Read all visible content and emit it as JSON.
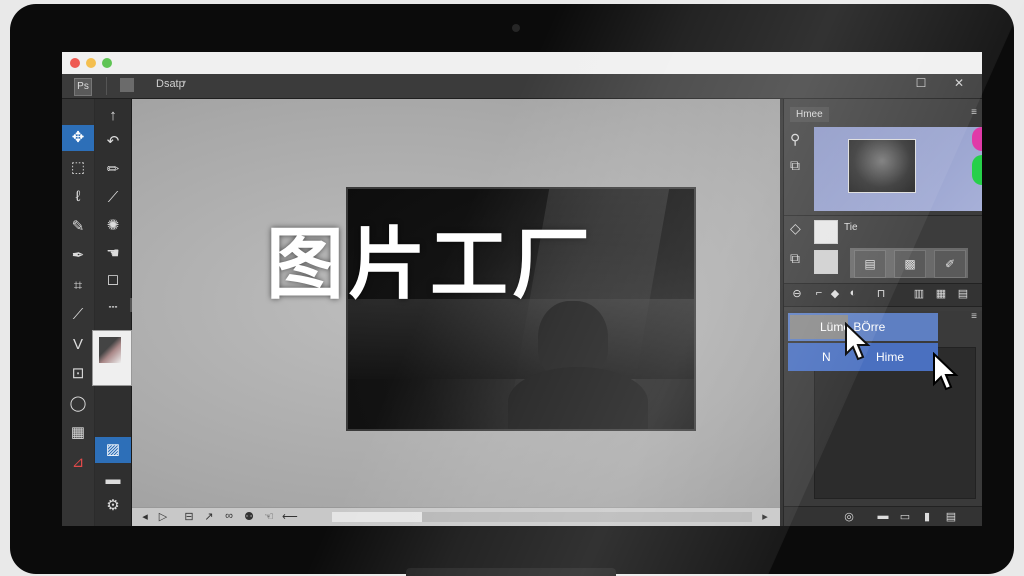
{
  "window": {
    "controls": [
      "close",
      "minimize",
      "maximize"
    ]
  },
  "menubar": {
    "logo_glyph": "Ps",
    "menu_label": "Dsatp",
    "dropdown_glyph": "▾",
    "restore_glyph": "☐",
    "close_glyph": "✕"
  },
  "tools_left": [
    {
      "name": "move-icon",
      "glyph": "✥",
      "active": true
    },
    {
      "name": "marquee-icon",
      "glyph": "⬚"
    },
    {
      "name": "lasso-icon",
      "glyph": "ℓ"
    },
    {
      "name": "brush-icon",
      "glyph": "✎"
    },
    {
      "name": "pen-icon",
      "glyph": "✒"
    },
    {
      "name": "crop-icon",
      "glyph": "⌗"
    },
    {
      "name": "eyedropper-icon",
      "glyph": "⟋"
    },
    {
      "name": "path-icon",
      "glyph": "V"
    },
    {
      "name": "shape-icon",
      "glyph": "⊡"
    },
    {
      "name": "ellipse-icon",
      "glyph": "◯"
    },
    {
      "name": "stamp-icon",
      "glyph": "▦"
    },
    {
      "name": "transform-icon",
      "glyph": "⊿"
    }
  ],
  "tools_right": [
    {
      "name": "arrow-up-icon",
      "glyph": "↑"
    },
    {
      "name": "undo-icon",
      "glyph": "↶"
    },
    {
      "name": "pencil-icon",
      "glyph": "✏"
    },
    {
      "name": "wand-icon",
      "glyph": "⟋"
    },
    {
      "name": "healing-icon",
      "glyph": "✺"
    },
    {
      "name": "smudge-icon",
      "glyph": "☚"
    },
    {
      "name": "rect-select-icon",
      "glyph": "◻"
    },
    {
      "name": "dotted-line-icon",
      "glyph": "┄"
    },
    {
      "name": "image-icon",
      "glyph": "▨"
    },
    {
      "name": "folder-icon",
      "glyph": "▬"
    },
    {
      "name": "settings-icon",
      "glyph": "⚙"
    }
  ],
  "canvas": {
    "title_overlay": "图片工厂",
    "scroll_up": "▲",
    "scroll_down": "▼"
  },
  "statusbar": {
    "icons": [
      {
        "name": "play-back-icon",
        "glyph": "◂"
      },
      {
        "name": "play-icon",
        "glyph": "▷"
      },
      {
        "name": "grid-icon",
        "glyph": "⊟"
      },
      {
        "name": "brush-small-icon",
        "glyph": "↗"
      },
      {
        "name": "link-icon",
        "glyph": "∞"
      },
      {
        "name": "stamp-small-icon",
        "glyph": "⚉"
      },
      {
        "name": "hand-icon",
        "glyph": "☜"
      },
      {
        "name": "arrow-left-icon",
        "glyph": "⟵"
      }
    ],
    "scroll_left": "◂",
    "scroll_right": "▸"
  },
  "navigator": {
    "tab_label": "Hmee",
    "menu_glyph": "≡",
    "icons": [
      {
        "name": "zoom-icon",
        "glyph": "⚲"
      },
      {
        "name": "copy-icon",
        "glyph": "⧉"
      }
    ]
  },
  "properties": {
    "label": "Tie",
    "buttons": [
      {
        "name": "adjust-button",
        "glyph": "▤"
      },
      {
        "name": "image-adjust-button",
        "glyph": "▩"
      },
      {
        "name": "edit-button",
        "glyph": "✐"
      }
    ]
  },
  "layer_tools": [
    {
      "name": "layer-link-icon",
      "glyph": "⊖"
    },
    {
      "name": "layer-crop-icon",
      "glyph": "⌐"
    },
    {
      "name": "layer-mask-icon",
      "glyph": "◆"
    },
    {
      "name": "layer-drop-icon",
      "glyph": "◐"
    },
    {
      "name": "layer-fx-icon",
      "glyph": "⊓"
    },
    {
      "name": "layer-new-icon",
      "glyph": "▥"
    },
    {
      "name": "layer-group-icon",
      "glyph": "▦"
    },
    {
      "name": "layer-trash-icon",
      "glyph": "▤"
    }
  ],
  "layers": {
    "menu_glyph": "≡",
    "items": [
      {
        "label": "Lüme BÖrre"
      },
      {
        "label_a": "N",
        "label_b": "Hime"
      }
    ]
  },
  "panel_footer": [
    {
      "name": "footer-circle-icon",
      "glyph": "◎"
    },
    {
      "name": "footer-folder-icon",
      "glyph": "▬"
    },
    {
      "name": "footer-page-icon",
      "glyph": "▭"
    },
    {
      "name": "footer-page2-icon",
      "glyph": "▮"
    },
    {
      "name": "footer-trash-icon",
      "glyph": "▤"
    }
  ],
  "colors": {
    "accent": "#2d6fb8",
    "layer_selected": "#5e7fc2",
    "nav_pink": "#e03aa8",
    "nav_green": "#26d04a"
  }
}
